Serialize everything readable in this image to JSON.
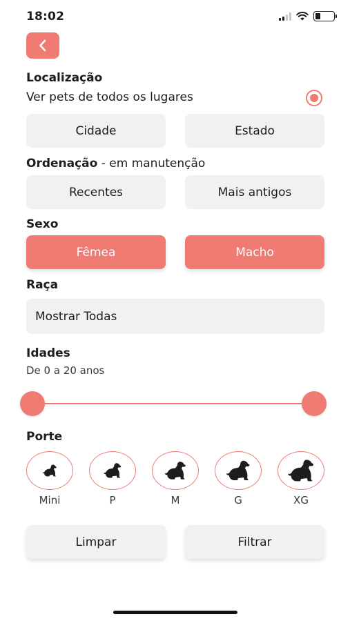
{
  "status_bar": {
    "time": "18:02"
  },
  "location": {
    "title": "Localização",
    "subtitle": "Ver pets de todos os lugares",
    "buttons": [
      "Cidade",
      "Estado"
    ]
  },
  "ordering": {
    "title": "Ordenação",
    "title_suffix": " - em manutenção",
    "buttons": [
      "Recentes",
      "Mais antigos"
    ]
  },
  "sex": {
    "title": "Sexo",
    "buttons": [
      "Fêmea",
      "Macho"
    ]
  },
  "breed": {
    "title": "Raça",
    "value": "Mostrar Todas"
  },
  "ages": {
    "title": "Idades",
    "range_text": "De 0 a 20 anos",
    "min": 0,
    "max": 20
  },
  "size": {
    "title": "Porte",
    "options": [
      "Mini",
      "P",
      "M",
      "G",
      "XG"
    ]
  },
  "actions": {
    "clear": "Limpar",
    "filter": "Filtrar"
  },
  "colors": {
    "accent": "#ef7b73",
    "button_bg": "#f1f1f1",
    "text": "#1d1d1d"
  }
}
